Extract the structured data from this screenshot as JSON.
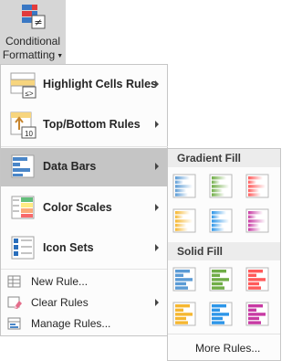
{
  "ribbon": {
    "label_line1": "Conditional",
    "label_line2": "Formatting"
  },
  "menu": {
    "big_items": [
      {
        "label": "Highlight Cells Rules",
        "mnemonic": "H"
      },
      {
        "label": "Top/Bottom Rules",
        "mnemonic": "T"
      },
      {
        "label": "Data Bars",
        "mnemonic": "D"
      },
      {
        "label": "Color Scales",
        "mnemonic": "S"
      },
      {
        "label": "Icon Sets",
        "mnemonic": "I"
      }
    ],
    "small_items": [
      {
        "label": "New Rule...",
        "mnemonic": "N"
      },
      {
        "label": "Clear Rules",
        "mnemonic": "C"
      },
      {
        "label": "Manage Rules...",
        "mnemonic": "R"
      }
    ]
  },
  "submenu": {
    "gradient_header": "Gradient Fill",
    "solid_header": "Solid Fill",
    "more_rules": "More Rules...",
    "colors": [
      "#5b9bd5",
      "#70ad47",
      "#ff5a5a",
      "#f5b731",
      "#2e96e8",
      "#c73aa3"
    ]
  },
  "colors": {
    "active_item": "#c5c5c5",
    "ribbon_active": "#d6d6d6"
  }
}
